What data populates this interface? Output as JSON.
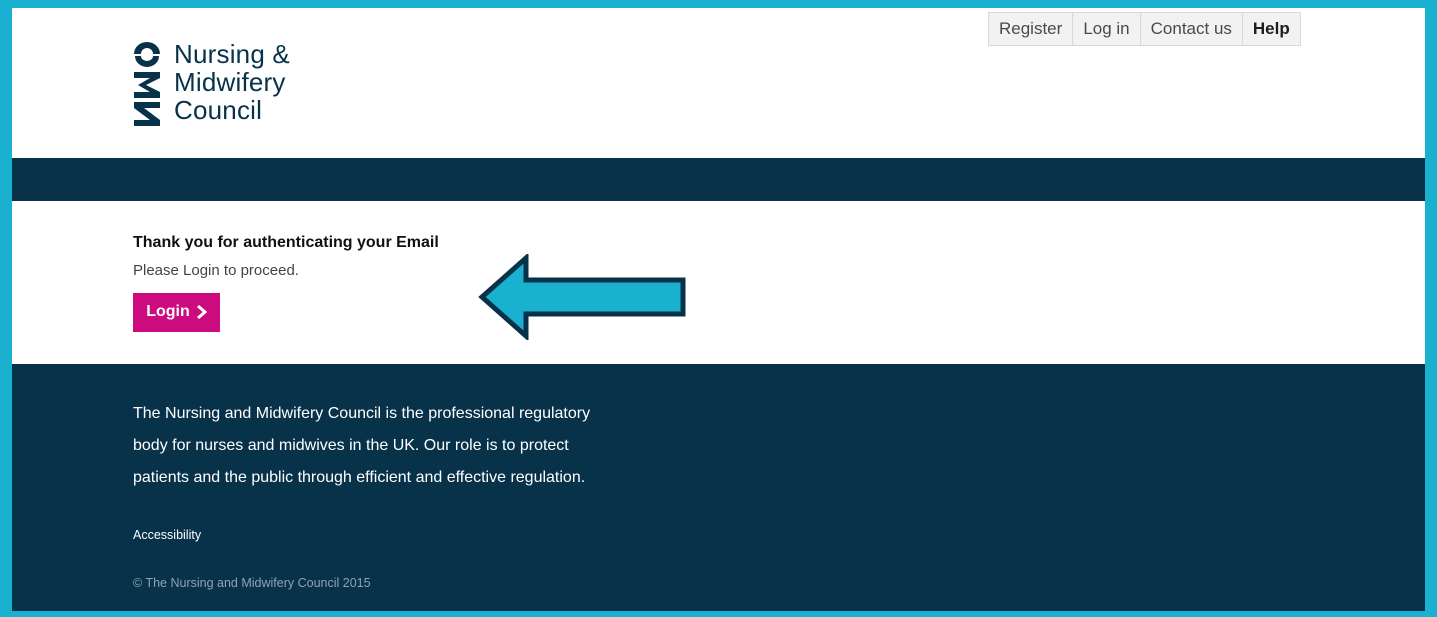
{
  "header": {
    "logo": {
      "mark_letters": "NMC",
      "lines": [
        "Nursing &",
        "Midwifery",
        "Council"
      ]
    },
    "top_nav": [
      {
        "label": "Register"
      },
      {
        "label": "Log in"
      },
      {
        "label": "Contact us"
      },
      {
        "label": "Help"
      }
    ]
  },
  "main": {
    "title": "Thank you for authenticating your Email",
    "subtitle": "Please Login to proceed.",
    "login_button": {
      "label": "Login",
      "icon": "chevron-right-icon"
    },
    "annotation": {
      "icon": "arrow-left-icon",
      "color": "#1ab0cf"
    }
  },
  "footer": {
    "about_lines": [
      "The Nursing and Midwifery Council is the professional regulatory",
      "body for nurses and midwives in the UK. Our role is to protect",
      "patients and the public through efficient and effective regulation."
    ],
    "accessibility_link": "Accessibility",
    "copyright": "© The Nursing and Midwifery Council 2015"
  },
  "colors": {
    "brand_navy": "#07324a",
    "button_magenta": "#cc0c7e",
    "frame_cyan": "#1ab0cf"
  }
}
